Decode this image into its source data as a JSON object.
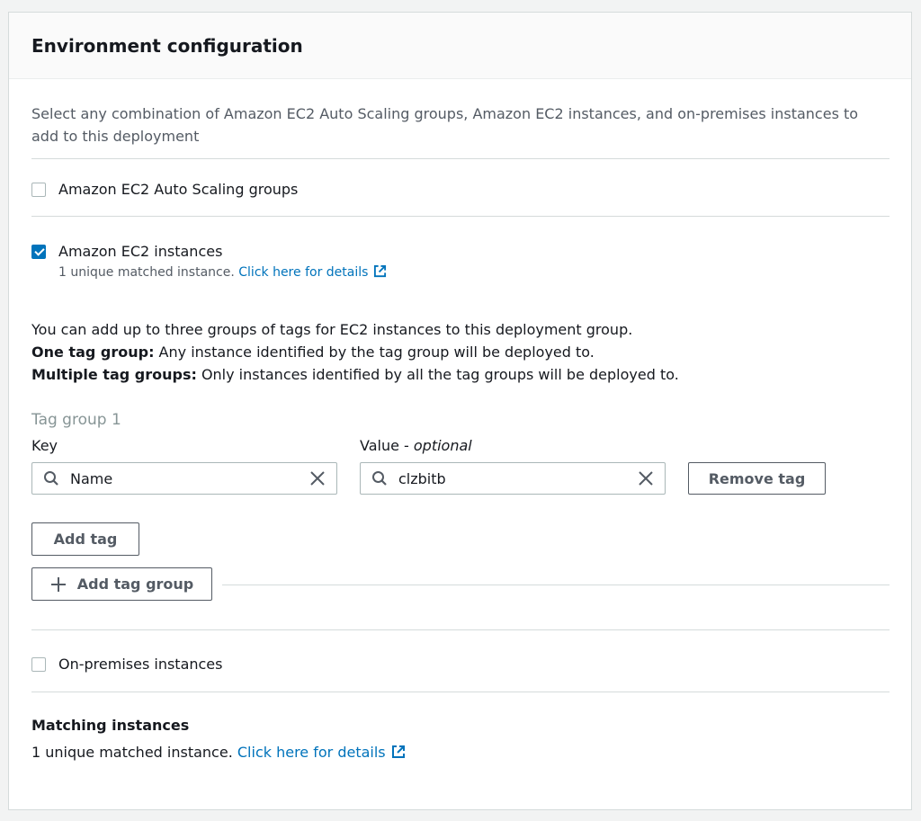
{
  "panel": {
    "title": "Environment configuration",
    "description": "Select any combination of Amazon EC2 Auto Scaling groups, Amazon EC2 instances, and on-premises instances to add to this deployment"
  },
  "options": {
    "asg": {
      "label": "Amazon EC2 Auto Scaling groups",
      "checked": false
    },
    "ec2": {
      "label": "Amazon EC2 instances",
      "checked": true,
      "matched_text": "1 unique matched instance.",
      "details_link": "Click here for details"
    },
    "onprem": {
      "label": "On-premises instances",
      "checked": false
    }
  },
  "tag_info": {
    "line1": "You can add up to three groups of tags for EC2 instances to this deployment group.",
    "one_group_label": "One tag group:",
    "one_group_text": " Any instance identified by the tag group will be deployed to.",
    "multi_group_label": "Multiple tag groups:",
    "multi_group_text": " Only instances identified by all the tag groups will be deployed to."
  },
  "tag_group": {
    "title": "Tag group 1",
    "key_label": "Key",
    "value_label": "Value - ",
    "value_optional": "optional",
    "key_value": "Name",
    "value_value": "clzbitb",
    "remove_button": "Remove tag",
    "add_tag_button": "Add tag",
    "add_group_button": "Add tag group"
  },
  "matching": {
    "title": "Matching instances",
    "text": "1 unique matched instance.",
    "link": "Click here for details"
  },
  "colors": {
    "accent": "#0073bb",
    "border": "#aab7b8",
    "text": "#16191f",
    "muted": "#545b64"
  },
  "icons": [
    "search-icon",
    "clear-icon",
    "external-link-icon",
    "plus-icon",
    "checkbox-checked-icon"
  ]
}
